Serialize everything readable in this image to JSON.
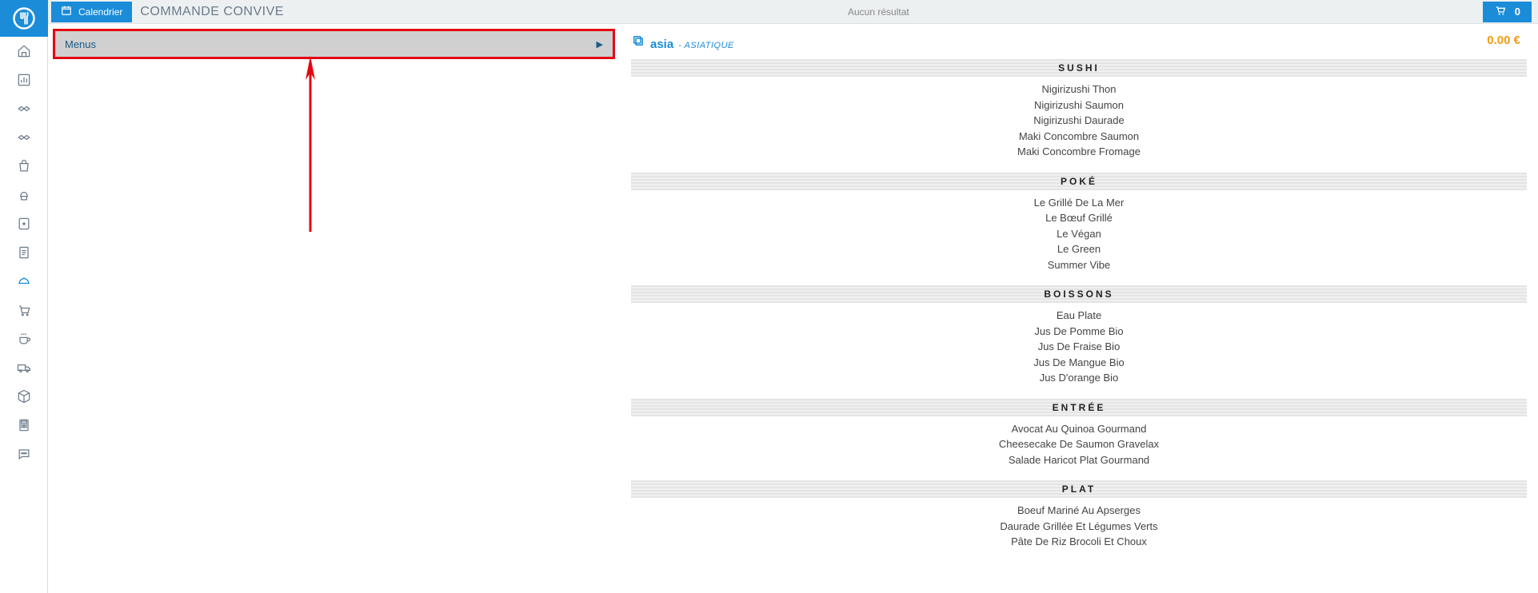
{
  "header": {
    "calendar_label": "Calendrier",
    "page_title": "COMMANDE CONVIVE",
    "no_result": "Aucun résultat",
    "cart_count": "0"
  },
  "left": {
    "menus_label": "Menus"
  },
  "menu": {
    "name": "asia",
    "subtitle": "- ASIATIQUE",
    "price": "0.00 €",
    "sections": [
      {
        "title": "SUSHI",
        "items": [
          "Nigirizushi Thon",
          "Nigirizushi Saumon",
          "Nigirizushi Daurade",
          "Maki Concombre Saumon",
          "Maki Concombre Fromage"
        ]
      },
      {
        "title": "POKÉ",
        "items": [
          "Le Grillé De La Mer",
          "Le Bœuf Grillé",
          "Le Végan",
          "Le Green",
          "Summer Vibe"
        ]
      },
      {
        "title": "BOISSONS",
        "items": [
          "Eau Plate",
          "Jus De Pomme Bio",
          "Jus De Fraise Bio",
          "Jus De Mangue Bio",
          "Jus D'orange Bio"
        ]
      },
      {
        "title": "ENTRÉE",
        "items": [
          "Avocat Au Quinoa Gourmand",
          "Cheesecake De Saumon Gravelax",
          "Salade Haricot Plat Gourmand"
        ]
      },
      {
        "title": "PLAT",
        "items": [
          "Boeuf Mariné Au Apserges",
          "Daurade Grillée Et Légumes Verts",
          "Pâte De Riz Brocoli Et Choux"
        ]
      }
    ]
  },
  "sidebar_icons": [
    "home-icon",
    "dashboard-icon",
    "handshake-icon",
    "handshake-alt-icon",
    "bag-icon",
    "chef-hat-icon",
    "favorite-list-icon",
    "document-icon",
    "cloche-icon",
    "cart-icon",
    "coffee-icon",
    "truck-icon",
    "package-icon",
    "calculator-icon",
    "chat-icon"
  ]
}
